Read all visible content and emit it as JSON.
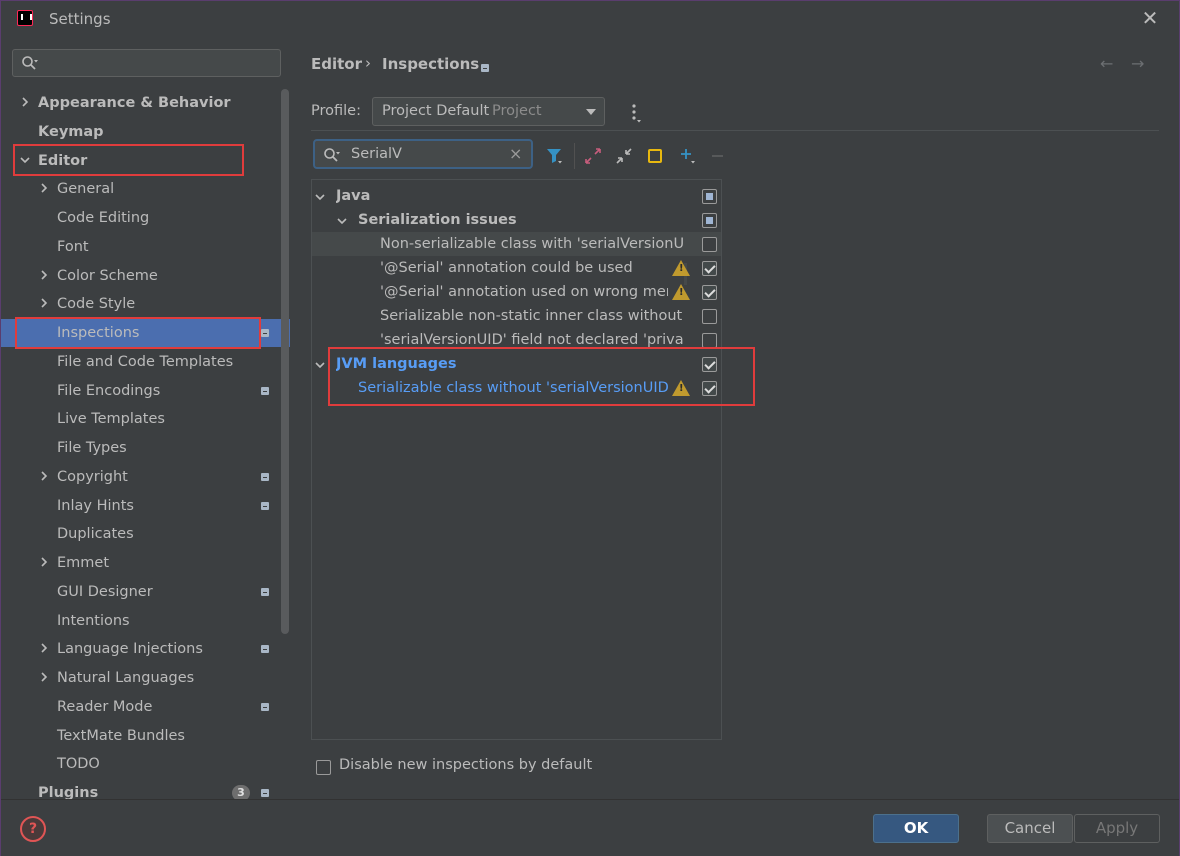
{
  "window": {
    "title": "Settings"
  },
  "sidebar": {
    "search_placeholder": "",
    "items": [
      {
        "label": "Appearance & Behavior",
        "bold": true,
        "arrow": "right",
        "indent": 0
      },
      {
        "label": "Keymap",
        "bold": true,
        "arrow": "",
        "indent": 0
      },
      {
        "label": "Editor",
        "bold": true,
        "arrow": "down",
        "indent": 0
      },
      {
        "label": "General",
        "arrow": "right",
        "indent": 1
      },
      {
        "label": "Code Editing",
        "arrow": "",
        "indent": 1
      },
      {
        "label": "Font",
        "arrow": "",
        "indent": 1
      },
      {
        "label": "Color Scheme",
        "arrow": "right",
        "indent": 1
      },
      {
        "label": "Code Style",
        "arrow": "right",
        "indent": 1
      },
      {
        "label": "Inspections",
        "arrow": "",
        "indent": 1,
        "selected": true,
        "project_icon": true
      },
      {
        "label": "File and Code Templates",
        "arrow": "",
        "indent": 1
      },
      {
        "label": "File Encodings",
        "arrow": "",
        "indent": 1,
        "project_icon": true
      },
      {
        "label": "Live Templates",
        "arrow": "",
        "indent": 1
      },
      {
        "label": "File Types",
        "arrow": "",
        "indent": 1
      },
      {
        "label": "Copyright",
        "arrow": "right",
        "indent": 1,
        "project_icon": true
      },
      {
        "label": "Inlay Hints",
        "arrow": "",
        "indent": 1,
        "project_icon": true
      },
      {
        "label": "Duplicates",
        "arrow": "",
        "indent": 1
      },
      {
        "label": "Emmet",
        "arrow": "right",
        "indent": 1
      },
      {
        "label": "GUI Designer",
        "arrow": "",
        "indent": 1,
        "project_icon": true
      },
      {
        "label": "Intentions",
        "arrow": "",
        "indent": 1
      },
      {
        "label": "Language Injections",
        "arrow": "right",
        "indent": 1,
        "project_icon": true
      },
      {
        "label": "Natural Languages",
        "arrow": "right",
        "indent": 1
      },
      {
        "label": "Reader Mode",
        "arrow": "",
        "indent": 1,
        "project_icon": true
      },
      {
        "label": "TextMate Bundles",
        "arrow": "",
        "indent": 1
      },
      {
        "label": "TODO",
        "arrow": "",
        "indent": 1
      },
      {
        "label": "Plugins",
        "bold": true,
        "arrow": "",
        "indent": 0,
        "badge": "3",
        "project_icon": true
      }
    ]
  },
  "breadcrumb": {
    "parent": "Editor",
    "separator": "›",
    "current": "Inspections"
  },
  "nav": {
    "back": "←",
    "forward": "→"
  },
  "profile": {
    "label": "Profile:",
    "value": "Project Default",
    "scope": "Project"
  },
  "filter": {
    "value": "SerialV",
    "clear": "×"
  },
  "inspections": [
    {
      "label": "Java",
      "level": 0,
      "bold": true,
      "arrow": "down",
      "check": "mixed"
    },
    {
      "label": "Serialization issues",
      "level": 1,
      "bold": true,
      "arrow": "down",
      "check": "mixed"
    },
    {
      "label": "Non-serializable class with 'serialVersionUID'",
      "level": 2,
      "check": "off",
      "highlight": true
    },
    {
      "label": "'@Serial' annotation could be used",
      "level": 2,
      "check": "on",
      "warning": true
    },
    {
      "label": "'@Serial' annotation used on wrong member",
      "level": 2,
      "check": "on",
      "warning": true
    },
    {
      "label": "Serializable non-static inner class without 'serialVersionUID'",
      "level": 2,
      "check": "off"
    },
    {
      "label": "'serialVersionUID' field not declared 'private static final long'",
      "level": 2,
      "check": "off"
    },
    {
      "label": "JVM languages",
      "level": 0,
      "bold": true,
      "arrow": "down",
      "check": "on",
      "blue": true
    },
    {
      "label": "Serializable class without 'serialVersionUID'",
      "level": 1,
      "check": "on",
      "warning": true,
      "blue": true
    }
  ],
  "disable_new": {
    "label": "Disable new inspections by default",
    "checked": false
  },
  "buttons": {
    "ok": "OK",
    "cancel": "Cancel",
    "apply": "Apply"
  },
  "help": "?",
  "colors": {
    "accent": "#4b6eaf",
    "link": "#589df6",
    "warning": "#c09a2e",
    "annotation_red": "#e03c3c"
  }
}
